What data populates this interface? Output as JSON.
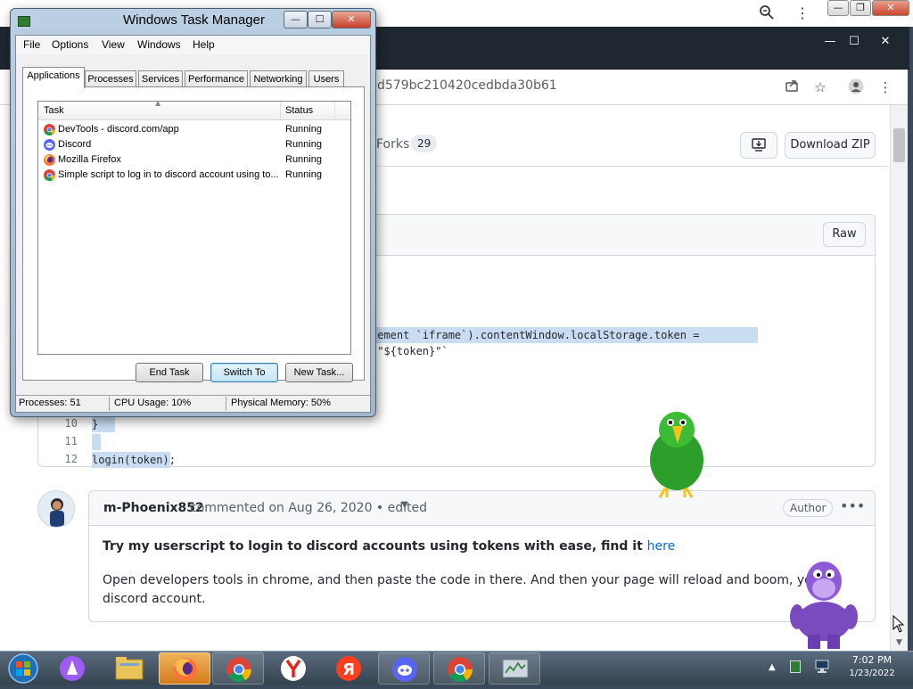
{
  "outer_browser": {
    "zoom_icon": "zoom-icon",
    "menu_icon": "vertical-ellipsis-icon",
    "minimize": "—",
    "restore": "❐",
    "close": "✕"
  },
  "inner_browser": {
    "minimize": "—",
    "maximize": "☐",
    "close": "✕",
    "address_fragment": "d579bc210420cedbda30b61"
  },
  "gist": {
    "forks_label": "Forks",
    "forks_count": "29",
    "download_zip": "Download ZIP",
    "raw_button": "Raw",
    "code_line_highlight": "lement `iframe`).contentWindow.localStorage.token = `\"${token}\"`",
    "code_lines": [
      {
        "number": "10",
        "text": "}"
      },
      {
        "number": "11",
        "text": ""
      },
      {
        "number": "12",
        "text": "login(token);"
      }
    ]
  },
  "comment": {
    "author": "m-Phoenix852",
    "meta": "commented on Aug 26, 2020 • edited",
    "author_badge": "Author",
    "body_bold": "Try my userscript to login to discord accounts using tokens with ease, find it",
    "body_link": "here",
    "body_line1": "Open developers tools in chrome, and then paste the code in there. And then your page will reload and boom, you will log in to",
    "body_line2": "discord account."
  },
  "task_manager": {
    "title": "Windows Task Manager",
    "menu": [
      "File",
      "Options",
      "View",
      "Windows",
      "Help"
    ],
    "tabs": [
      "Applications",
      "Processes",
      "Services",
      "Performance",
      "Networking",
      "Users"
    ],
    "active_tab": "Applications",
    "columns": [
      "Task",
      "Status"
    ],
    "rows": [
      {
        "task": "DevTools - discord.com/app",
        "status": "Running",
        "icon": "chrome-icon"
      },
      {
        "task": "Discord",
        "status": "Running",
        "icon": "discord-icon"
      },
      {
        "task": "Mozilla Firefox",
        "status": "Running",
        "icon": "firefox-icon"
      },
      {
        "task": "Simple script to log in to discord account using to...",
        "status": "Running",
        "icon": "chrome-icon"
      }
    ],
    "buttons": {
      "end_task": "End Task",
      "switch_to": "Switch To",
      "new_task": "New Task..."
    },
    "status_bar": {
      "processes": "Processes: 51",
      "cpu": "CPU Usage: 10%",
      "memory": "Physical Memory: 50%"
    }
  },
  "taskbar": {
    "items": [
      "start-orb",
      "assistant",
      "file-explorer",
      "firefox",
      "chrome",
      "yandex-browser",
      "yandex",
      "discord",
      "chrome",
      "task-manager"
    ],
    "clock_time": "7:02 PM",
    "clock_date": "1/23/2022"
  },
  "colors": {
    "link": "#0969da",
    "highlight": "#c9dcf2",
    "taskbar": "#34434f",
    "active_taskbar": "#e69a3a"
  }
}
